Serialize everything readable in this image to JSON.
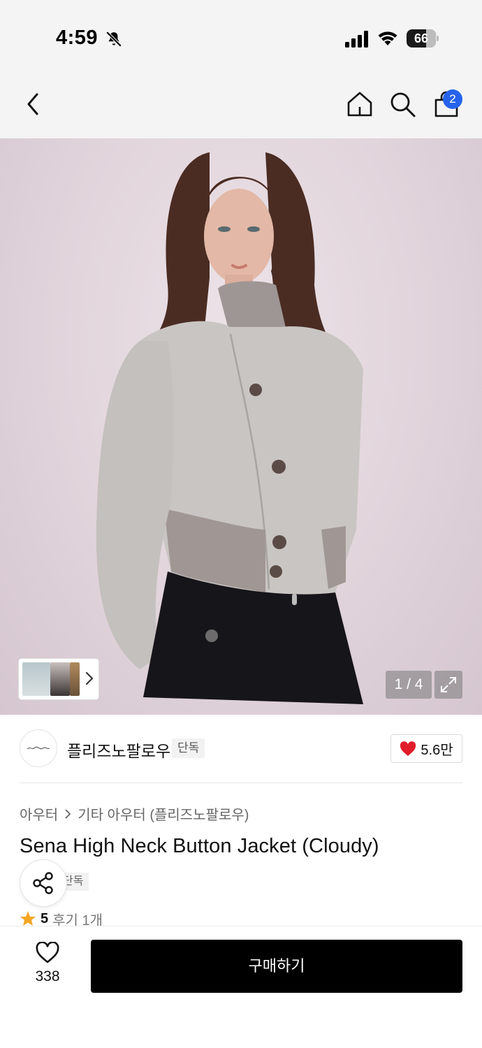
{
  "status_bar": {
    "time": "4:59",
    "battery": "66"
  },
  "nav": {
    "icons": [
      "back-chevron-icon",
      "home-icon",
      "search-icon",
      "shopping-bag-icon"
    ],
    "cart_count": "2"
  },
  "gallery": {
    "current_image": 1,
    "total_images": 4,
    "counter_text": "1 / 4"
  },
  "brand": {
    "name": "플리즈노팔로우",
    "badge": "단독",
    "likes": "5.6만"
  },
  "product": {
    "breadcrumb": [
      "아우터",
      "기타 아우터 (플리즈노팔로우)"
    ],
    "title": "Sena High Neck Button Jacket (Cloudy)",
    "tag": "단독",
    "rating": "5",
    "reviews": "후기 1개"
  },
  "bottom_bar": {
    "wishlist_count": "338",
    "buy_label": "구매하기"
  },
  "colors": {
    "accent_blue": "#2563eb",
    "heart_red": "#e11d2a",
    "star_orange": "#f5a623",
    "buy_black": "#000000"
  }
}
